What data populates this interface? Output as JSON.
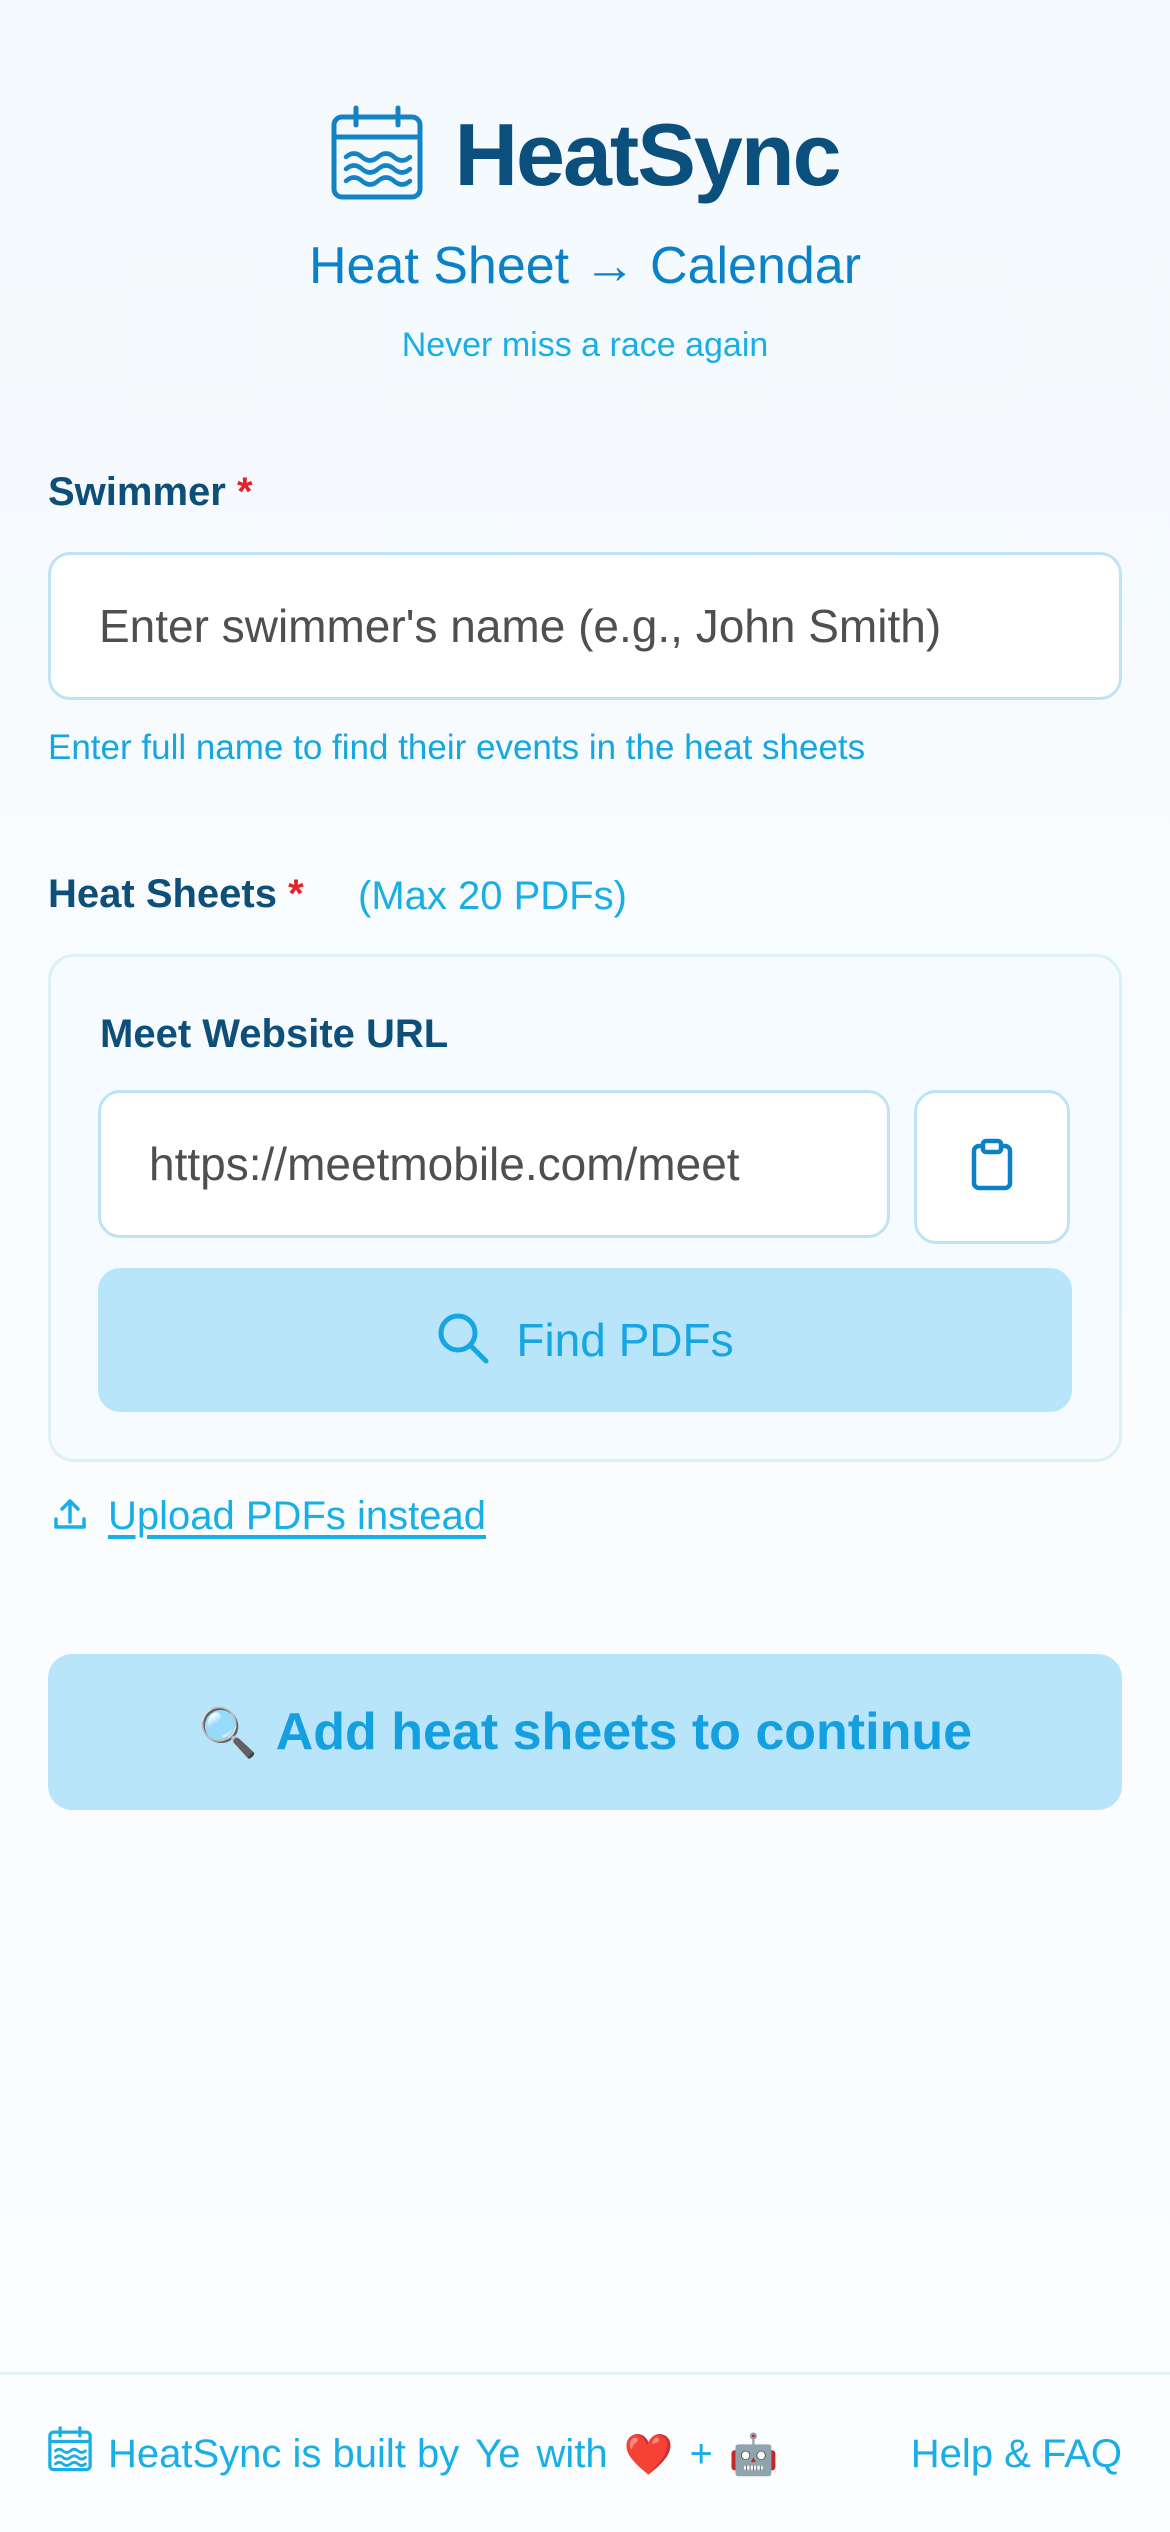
{
  "header": {
    "brand_name": "HeatSync",
    "tagline": "Heat Sheet → Calendar",
    "subtagline": "Never miss a race again"
  },
  "swimmer": {
    "label": "Swimmer",
    "required_mark": "*",
    "placeholder": "Enter swimmer's name (e.g., John Smith)",
    "hint": "Enter full name to find their events in the heat sheets"
  },
  "heat_sheets": {
    "label": "Heat Sheets",
    "required_mark": "*",
    "max_note": "(Max 20 PDFs)",
    "url_label": "Meet Website URL",
    "url_placeholder": "https://meetmobile.com/meet",
    "find_button_label": "Find PDFs",
    "upload_link_label": "Upload PDFs instead"
  },
  "continue_button": {
    "emoji": "🔍",
    "label": "Add heat sheets to continue"
  },
  "footer": {
    "built_by_text": "HeatSync is built by",
    "author": "Ye",
    "with_text": "with",
    "heart_emoji": "❤️",
    "plus": "+",
    "robot_emoji": "🤖",
    "help_link": "Help & FAQ"
  },
  "colors": {
    "brand_dark": "#0b4f7c",
    "brand_blue": "#0b82c8",
    "accent_light_blue": "#19aee6",
    "button_bg": "#b9e5fb",
    "required_red": "#e3222e"
  },
  "icons": [
    "calendar-waves-icon",
    "clipboard-icon",
    "search-icon",
    "upload-icon"
  ]
}
